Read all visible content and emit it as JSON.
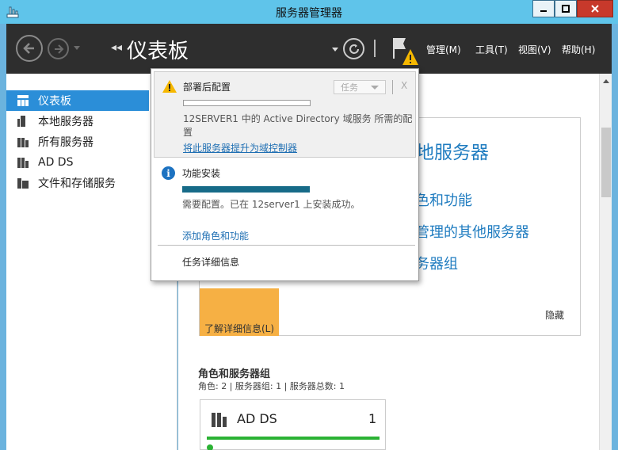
{
  "window": {
    "title": "服务器管理器",
    "minimize": "—",
    "maximize": "□",
    "close": "✕"
  },
  "header": {
    "title": "仪表板",
    "breadcrumb_arrows": "◂◂",
    "menus": [
      "管理(M)",
      "工具(T)",
      "视图(V)",
      "帮助(H)"
    ]
  },
  "sidebar": {
    "items": [
      {
        "label": "仪表板",
        "icon": "dashboard-icon",
        "active": true
      },
      {
        "label": "本地服务器",
        "icon": "server-icon",
        "active": false
      },
      {
        "label": "所有服务器",
        "icon": "servers-icon",
        "active": false
      },
      {
        "label": "AD DS",
        "icon": "ad-ds-icon",
        "active": false
      },
      {
        "label": "文件和存储服务",
        "icon": "file-storage-icon",
        "active": false
      }
    ]
  },
  "welcome": {
    "heading": "本地服务器",
    "links": [
      "色和功能",
      "管理的其他服务器",
      "务器组"
    ],
    "learn_more": "了解详细信息(L)",
    "hide": "隐藏"
  },
  "roles": {
    "title": "角色和服务器组",
    "subtitle": "角色: 2 | 服务器组: 1 | 服务器总数: 1",
    "cards": [
      {
        "name": "AD DS",
        "count": "1"
      }
    ]
  },
  "notifications": {
    "post_deploy": {
      "title": "部署后配置",
      "task_label": "任务",
      "dismiss": "X",
      "description": "12SERVER1 中的 Active Directory 域服务 所需的配置",
      "link": "将此服务器提升为域控制器"
    },
    "feature_install": {
      "title": "功能安装",
      "progress": 1.0,
      "description": "需要配置。已在 12server1 上安装成功。",
      "link": "添加角色和功能"
    },
    "details": "任务详细信息"
  },
  "colors": {
    "titlebar": "#5fc4ea",
    "header": "#2e2e2e",
    "accent": "#2b8ed8",
    "link": "#1f7cc0",
    "warning": "#f6b044",
    "progress": "#176b88",
    "ok": "#2bb234"
  }
}
